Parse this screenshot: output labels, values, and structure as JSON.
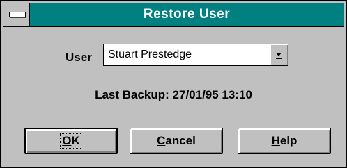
{
  "window": {
    "title": "Restore User",
    "colors": {
      "titlebar": "#008080",
      "face": "#c0c0c0"
    }
  },
  "user_field": {
    "label_mnemonic": "U",
    "label_rest": "ser",
    "selected_value": "Stuart Prestedge",
    "dropdown_icon": "chevron-down-icon"
  },
  "last_backup": {
    "text": "Last Backup: 27/01/95 13:10"
  },
  "buttons": {
    "ok": {
      "mnemonic": "O",
      "rest": "K"
    },
    "cancel": {
      "mnemonic": "C",
      "rest": "ancel"
    },
    "help": {
      "mnemonic": "H",
      "rest": "elp"
    }
  }
}
